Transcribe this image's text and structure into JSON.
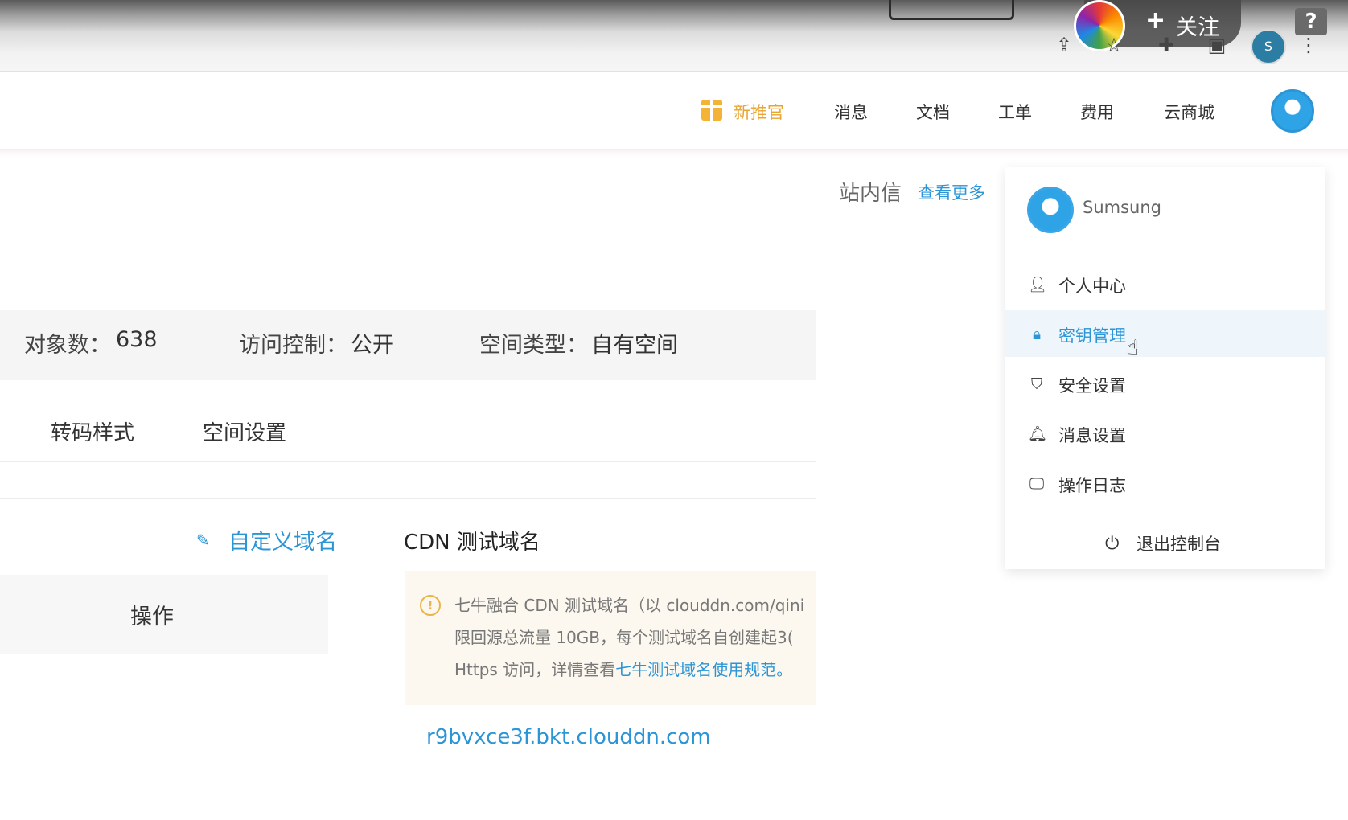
{
  "browser": {
    "follow_button": "关注",
    "profile_initial": "S"
  },
  "top_nav": {
    "items": [
      "新推官",
      "消息",
      "文档",
      "工单",
      "费用",
      "云商城"
    ]
  },
  "bucket_stats": {
    "object_count_label": "对象数：",
    "object_count_value": "638",
    "access_control_label": "访问控制：",
    "access_control_value": "公开",
    "space_type_label": "空间类型：",
    "space_type_value": "自有空间"
  },
  "tabs": [
    "转码样式",
    "空间设置"
  ],
  "domain_section": {
    "custom_domain_button": "自定义域名",
    "operations_header": "操作",
    "cdn_title": "CDN 测试域名",
    "notice_line1": "七牛融合 CDN 测试域名（以 clouddn.com/qini",
    "notice_line2": "限回源总流量 10GB，每个测试域名自创建起3(",
    "notice_line3_prefix": "Https 访问，详情查看",
    "notice_line3_link": "七牛测试域名使用规范",
    "notice_line3_suffix": "。",
    "test_domain": "r9bvxce3f.bkt.clouddn.com"
  },
  "message_panel": {
    "title": "站内信",
    "more_link": "查看更多"
  },
  "user_menu": {
    "username": "Sumsung",
    "items": [
      {
        "label": "个人中心",
        "icon": "user-icon",
        "active": false
      },
      {
        "label": "密钥管理",
        "icon": "lock-icon",
        "active": true
      },
      {
        "label": "安全设置",
        "icon": "shield-icon",
        "active": false
      },
      {
        "label": "消息设置",
        "icon": "bell-icon",
        "active": false
      },
      {
        "label": "操作日志",
        "icon": "monitor-icon",
        "active": false
      }
    ],
    "logout": "退出控制台"
  },
  "colors": {
    "accent": "#2b95d6",
    "promo": "#f5b335",
    "notice_bg": "#fdf8ef"
  }
}
